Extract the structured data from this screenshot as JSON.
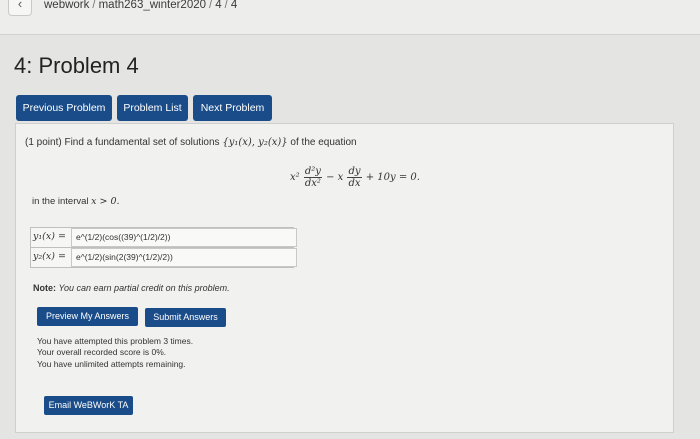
{
  "breadcrumb": {
    "parts": [
      "webwork",
      "math263_winter2020",
      "4",
      "4"
    ],
    "separator": "/"
  },
  "page_title": "4: Problem 4",
  "nav": {
    "previous": "Previous Problem",
    "list": "Problem List",
    "next": "Next Problem"
  },
  "problem": {
    "statement_prefix": "(1 point) Find a fundamental set of solutions",
    "solution_set": "{y₁(x), y₂(x)}",
    "statement_suffix": "of the equation",
    "equation": {
      "x2": "x²",
      "d2y": "d²y",
      "dx2": "dx²",
      "minus_x": "− x",
      "dy": "dy",
      "dx": "dx",
      "rest": "+ 10y = 0."
    },
    "interval_prefix": "in the interval",
    "interval_math": "x > 0."
  },
  "answers": [
    {
      "label": "y₁(x) =",
      "value": "e^(1/2)(cos((39)^(1/2)/2))"
    },
    {
      "label": "y₂(x) =",
      "value": "e^(1/2)(sin(2(39)^(1/2)/2))"
    }
  ],
  "note": {
    "bold": "Note:",
    "text": "You can earn partial credit on this problem."
  },
  "actions": {
    "preview": "Preview My Answers",
    "submit": "Submit Answers"
  },
  "attempts": [
    "You have attempted this problem 3 times.",
    "Your overall recorded score is 0%.",
    "You have unlimited attempts remaining."
  ],
  "email": "Email WeBWorK TA",
  "colors": {
    "button": "#1a4c89",
    "background": "#e4e4e2"
  }
}
